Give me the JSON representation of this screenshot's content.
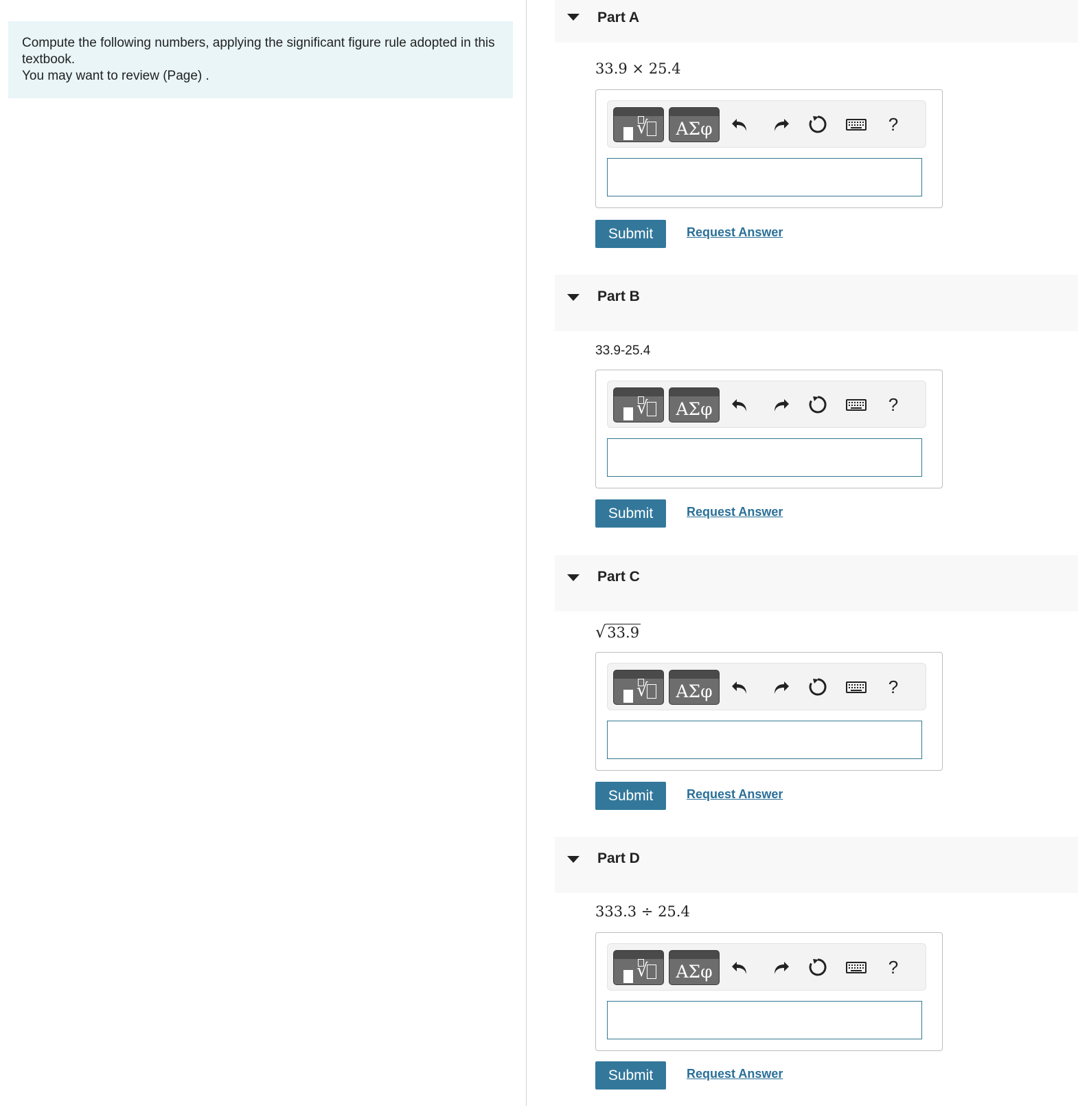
{
  "intro": {
    "line1": "Compute the following numbers, applying the significant figure rule adopted in this textbook.",
    "line2": "You may want to review (Page) ."
  },
  "toolbar": {
    "symbols_label": "ΑΣφ",
    "help_label": "?"
  },
  "parts": [
    {
      "title": "Part A",
      "question": "33.9 × 25.4",
      "answer_value": "",
      "submit_label": "Submit",
      "request_label": "Request Answer"
    },
    {
      "title": "Part B",
      "question": "33.9-25.4",
      "answer_value": "",
      "submit_label": "Submit",
      "request_label": "Request Answer"
    },
    {
      "title": "Part C",
      "question_radicand": "33.9",
      "answer_value": "",
      "submit_label": "Submit",
      "request_label": "Request Answer"
    },
    {
      "title": "Part D",
      "question": "333.3 ÷ 25.4",
      "answer_value": "",
      "submit_label": "Submit",
      "request_label": "Request Answer"
    }
  ],
  "colors": {
    "intro_bg": "#e9f5f7",
    "submit_bg": "#33789b",
    "link": "#2a6f97",
    "input_border": "#33788f"
  }
}
